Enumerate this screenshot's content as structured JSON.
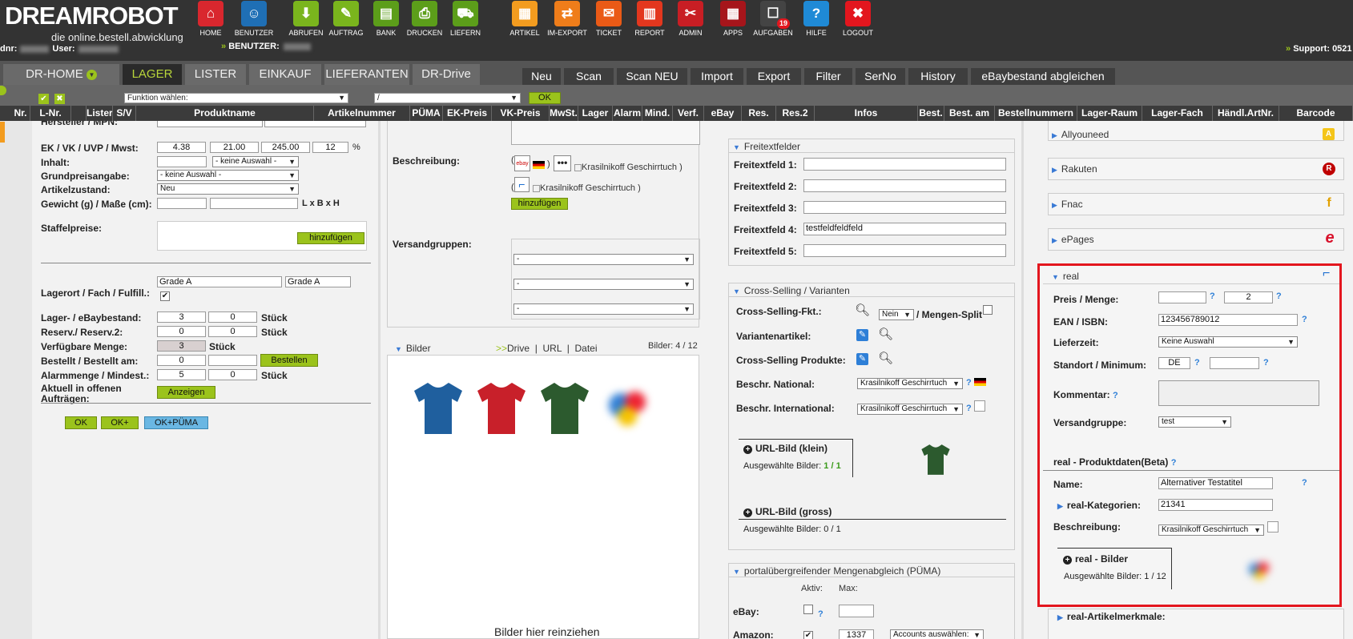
{
  "brand": {
    "logo_a": "DREAM",
    "logo_b": "ROBOT",
    "tagline": "die online.bestell.abwicklung",
    "kdnr_label": "dnr:",
    "user_label": "User:",
    "benutzer_label": "BENUTZER:",
    "support_label": "Support: 0521"
  },
  "nav": [
    {
      "label": "HOME",
      "icon": "home-icon",
      "color": "#d9272e",
      "glyph": "⌂"
    },
    {
      "label": "BENUTZER",
      "icon": "user-icon",
      "color": "#1f6fb5",
      "glyph": "☺"
    },
    {
      "label": "ABRUFEN",
      "icon": "download-icon",
      "color": "#7ab51d",
      "glyph": "⬇"
    },
    {
      "label": "AUFTRAG",
      "icon": "order-icon",
      "color": "#7ab51d",
      "glyph": "✎"
    },
    {
      "label": "BANK",
      "icon": "bank-icon",
      "color": "#5c9e1a",
      "glyph": "▤"
    },
    {
      "label": "DRUCKEN",
      "icon": "print-icon",
      "color": "#5c9e1a",
      "glyph": "⎙"
    },
    {
      "label": "LIEFERN",
      "icon": "cart-icon",
      "color": "#5c9e1a",
      "glyph": "⛟"
    },
    {
      "label": "ARTIKEL",
      "icon": "box-icon",
      "color": "#f39c1f",
      "glyph": "▦"
    },
    {
      "label": "IM-EXPORT",
      "icon": "import-export-icon",
      "color": "#ef7d1a",
      "glyph": "⇄"
    },
    {
      "label": "TICKET",
      "icon": "mail-icon",
      "color": "#ea5a16",
      "glyph": "✉"
    },
    {
      "label": "REPORT",
      "icon": "report-icon",
      "color": "#e3371e",
      "glyph": "▥"
    },
    {
      "label": "ADMIN",
      "icon": "admin-tools-icon",
      "color": "#c81e24",
      "glyph": "✂"
    },
    {
      "label": "APPS",
      "icon": "apps-icon",
      "color": "#a6151b",
      "glyph": "▦"
    },
    {
      "label": "AUFGABEN",
      "icon": "tasks-icon",
      "color": "#444",
      "glyph": "☐",
      "badge": "19"
    },
    {
      "label": "HILFE",
      "icon": "help-icon",
      "color": "#1f8ad6",
      "glyph": "?"
    },
    {
      "label": "LOGOUT",
      "icon": "logout-icon",
      "color": "#e3161e",
      "glyph": "✖"
    }
  ],
  "main_tabs": [
    "DR-HOME",
    "LAGER",
    "LISTER",
    "EINKAUF",
    "LIEFERANTEN",
    "DR-Drive"
  ],
  "sub_tabs": [
    "Neu",
    "Scan",
    "Scan NEU",
    "Import",
    "Export",
    "Filter",
    "SerNo",
    "History",
    "eBaybestand abgleichen"
  ],
  "funcbar": {
    "func_select": "Funktion wählen:",
    "path_select": "/",
    "ok": "OK"
  },
  "columns": [
    "Nr.",
    "L-Nr.",
    "Lister",
    "S/V",
    "Produktname",
    "Artikelnummer",
    "PÜMA",
    "EK-Preis",
    "VK-Preis",
    "MwSt.",
    "Lager",
    "Alarm",
    "Mind.",
    "Verf.",
    "eBay",
    "Res.",
    "Res.2",
    "Infos",
    "Best.",
    "Best. am",
    "Bestellnummern",
    "Lager-Raum",
    "Lager-Fach",
    "Händl.ArtNr.",
    "Barcode"
  ],
  "left": {
    "hersteller": "Hersteller / MPN:",
    "ek_label": "EK / VK / UVP / Mwst:",
    "ek": "4.38",
    "vk": "21.00",
    "uvp": "245.00",
    "mwst": "12",
    "pct": "%",
    "inhalt_label": "Inhalt:",
    "inhalt_sel": "- keine Auswahl -",
    "grund_label": "Grundpreisangabe:",
    "grund_sel": "- keine Auswahl -",
    "zustand_label": "Artikelzustand:",
    "zustand_sel": "Neu",
    "gewicht_label": "Gewicht (g) / Maße (cm):",
    "lbh": "L x B x H",
    "staffel_label": "Staffelpreise:",
    "hinzufuegen": "hinzufügen",
    "lagerort_label": "Lagerort / Fach / Fulfill.:",
    "fach1": "Grade A",
    "fach2": "Grade A",
    "lager_label": "Lager- / eBaybestand:",
    "lager1": "3",
    "lager2": "0",
    "stueck": "Stück",
    "reserv_label": "Reserv./ Reserv.2:",
    "reserv1": "0",
    "reserv2": "0",
    "verf_label": "Verfügbare Menge:",
    "verf": "3",
    "bestellt_label": "Bestellt / Bestellt am:",
    "bestellt": "0",
    "bestellen": "Bestellen",
    "alarm_label": "Alarmmenge / Mindest.:",
    "alarm1": "5",
    "alarm2": "0",
    "offen_label1": "Aktuell in offenen",
    "offen_label2": "Aufträgen:",
    "anzeigen": "Anzeigen",
    "ok": "OK",
    "okplus": "OK+",
    "okpuema": "OK+PÜMA"
  },
  "mid": {
    "beschreibung_label": "Beschreibung:",
    "img_alt": "Krasilnikoff Geschirrtuch",
    "hinzufuegen": "hinzufügen",
    "versand_label": "Versandgruppen:",
    "vg": "-",
    "bilder": "Bilder",
    "drive": "Drive",
    "url": "URL",
    "datei": "Datei",
    "bilder_count": "Bilder: 4 / 12",
    "dropzone": "Bilder hier reinziehen"
  },
  "freitext": {
    "title": "Freitextfelder",
    "fields": [
      {
        "label": "Freitextfeld 1:",
        "value": ""
      },
      {
        "label": "Freitextfeld 2:",
        "value": ""
      },
      {
        "label": "Freitextfeld 3:",
        "value": ""
      },
      {
        "label": "Freitextfeld 4:",
        "value": "testfeldfeldfeld"
      },
      {
        "label": "Freitextfeld 5:",
        "value": ""
      }
    ]
  },
  "cross": {
    "title": "Cross-Selling / Varianten",
    "fkt_label": "Cross-Selling-Fkt.:",
    "fkt_sel": "Nein",
    "mengen": "/ Mengen-Split",
    "varianten": "Variantenartikel:",
    "produkte": "Cross-Selling Produkte:",
    "national_label": "Beschr. National:",
    "national_sel": "Krasilnikoff Geschirrtuch",
    "intl_label": "Beschr. International:",
    "intl_sel": "Krasilnikoff Geschirrtuch",
    "url_klein": "URL-Bild (klein)",
    "ausg_klein_label": "Ausgewählte Bilder:",
    "ausg_klein": "1 / 1",
    "url_gross": "URL-Bild (gross)",
    "ausg_gross": "Ausgewählte Bilder: 0 / 1"
  },
  "puema": {
    "title": "portalübergreifender Mengenabgleich (PÜMA)",
    "aktiv": "Aktiv:",
    "max": "Max:",
    "ebay": "eBay:",
    "amazon": "Amazon:",
    "amazon_max": "1337",
    "accounts": "Accounts auswählen:"
  },
  "markets": [
    "Allyouneed",
    "Rakuten",
    "Fnac",
    "ePages"
  ],
  "real": {
    "title": "real",
    "preis_label": "Preis / Menge:",
    "menge": "2",
    "ean_label": "EAN / ISBN:",
    "ean": "123456789012",
    "liefer_label": "Lieferzeit:",
    "liefer_sel": "Keine Auswahl",
    "standort_label": "Standort / Minimum:",
    "standort": "DE",
    "kommentar_label": "Kommentar:",
    "versand_label": "Versandgruppe:",
    "versand_sel": "test",
    "produktdaten": "real - Produktdaten(Beta)",
    "name_label": "Name:",
    "name": "Alternativer Testatitel",
    "kat_label": "real-Kategorien:",
    "kat": "21341",
    "beschr_label": "Beschreibung:",
    "beschr_sel": "Krasilnikoff Geschirrtuch",
    "bilder": "real - Bilder",
    "bilder_ausg": "Ausgewählte Bilder: 1 / 12",
    "merkmale": "real-Artikelmerkmale:"
  },
  "colors": {
    "accent_green": "#9bc31c",
    "highlight_red": "#e3161e",
    "tab_active_text": "#b8d53a",
    "link_blue": "#2e7fd7"
  }
}
